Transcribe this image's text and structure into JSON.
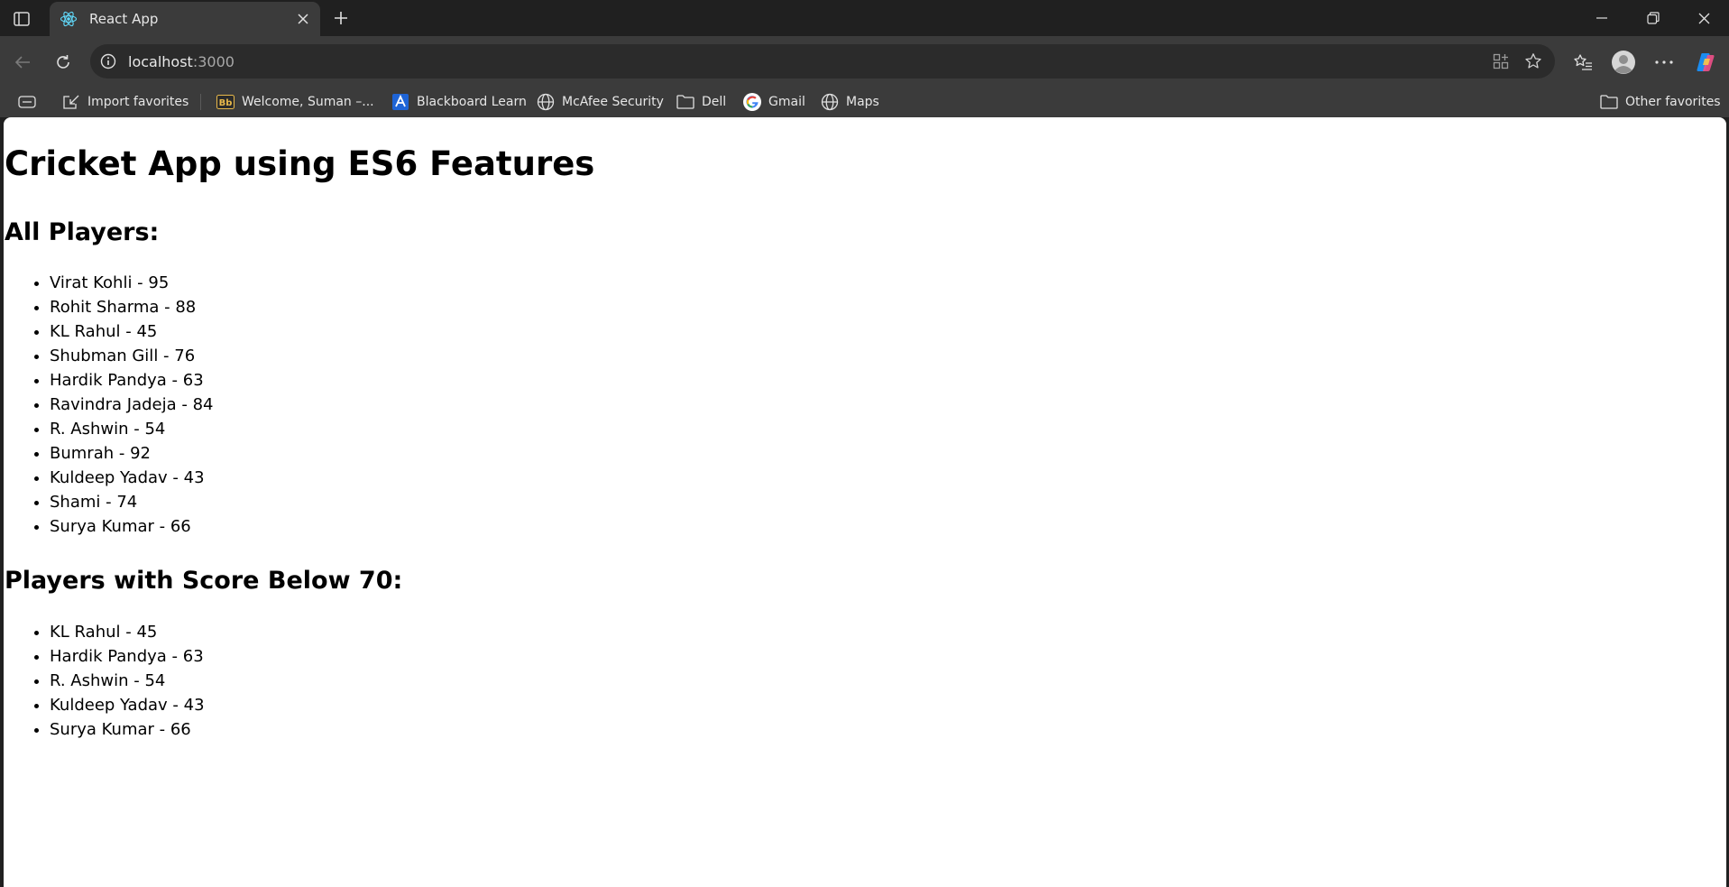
{
  "browser": {
    "tab": {
      "title": "React App"
    },
    "address": {
      "host": "localhost",
      "port": ":3000"
    },
    "favorites": [
      {
        "label": "Import favorites",
        "icon": "import-icon"
      },
      {
        "label": "Welcome, Suman –...",
        "icon": "bb-icon"
      },
      {
        "label": "Blackboard Learn",
        "icon": "blackboard-icon"
      },
      {
        "label": "McAfee Security",
        "icon": "globe-icon"
      },
      {
        "label": "Dell",
        "icon": "folder-icon"
      },
      {
        "label": "Gmail",
        "icon": "google-icon"
      },
      {
        "label": "Maps",
        "icon": "globe-icon"
      }
    ],
    "other_favorites": "Other favorites",
    "colors": {
      "chrome": "#202020",
      "toolbar": "#3b3b3b",
      "page": "#ffffff"
    }
  },
  "app": {
    "title": "Cricket App using ES6 Features",
    "all_players_heading": "All Players:",
    "all_players": [
      "Virat Kohli - 95",
      "Rohit Sharma - 88",
      "KL Rahul - 45",
      "Shubman Gill - 76",
      "Hardik Pandya - 63",
      "Ravindra Jadeja - 84",
      "R. Ashwin - 54",
      "Bumrah - 92",
      "Kuldeep Yadav - 43",
      "Shami - 74",
      "Surya Kumar - 66"
    ],
    "below_70_heading": "Players with Score Below 70:",
    "below_70": [
      "KL Rahul - 45",
      "Hardik Pandya - 63",
      "R. Ashwin - 54",
      "Kuldeep Yadav - 43",
      "Surya Kumar - 66"
    ]
  }
}
